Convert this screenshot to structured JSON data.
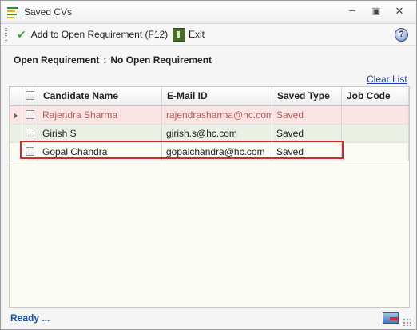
{
  "window": {
    "title": "Saved CVs",
    "controls": {
      "minimize": "─",
      "maximize": "▣",
      "close": "✕"
    }
  },
  "toolbar": {
    "add_label": "Add to Open Requirement (F12)",
    "exit_label": "Exit",
    "help_glyph": "?"
  },
  "requirement": {
    "label": "Open Requirement",
    "separator": ":",
    "value": "No Open Requirement"
  },
  "clear_list_label": "Clear List",
  "grid": {
    "columns": [
      "Candidate Name",
      "E-Mail ID",
      "Saved Type",
      "Job Code"
    ],
    "rows": [
      {
        "name": "Rajendra Sharma",
        "email": "rajendrasharma@hc.com",
        "type": "Saved",
        "job": ""
      },
      {
        "name": "Girish S",
        "email": "girish.s@hc.com",
        "type": "Saved",
        "job": ""
      },
      {
        "name": "Gopal Chandra",
        "email": "gopalchandra@hc.com",
        "type": "Saved",
        "job": ""
      }
    ]
  },
  "status_text": "Ready ...",
  "colors": {
    "highlight_border": "#d12a2a",
    "selected_row_bg": "#fae4e4",
    "link": "#1a3fbf",
    "status": "#1e4fb8"
  },
  "icons": [
    "app-menu-icon",
    "check-icon",
    "exit-icon",
    "help-icon",
    "row-indicator-icon",
    "status-icon"
  ]
}
